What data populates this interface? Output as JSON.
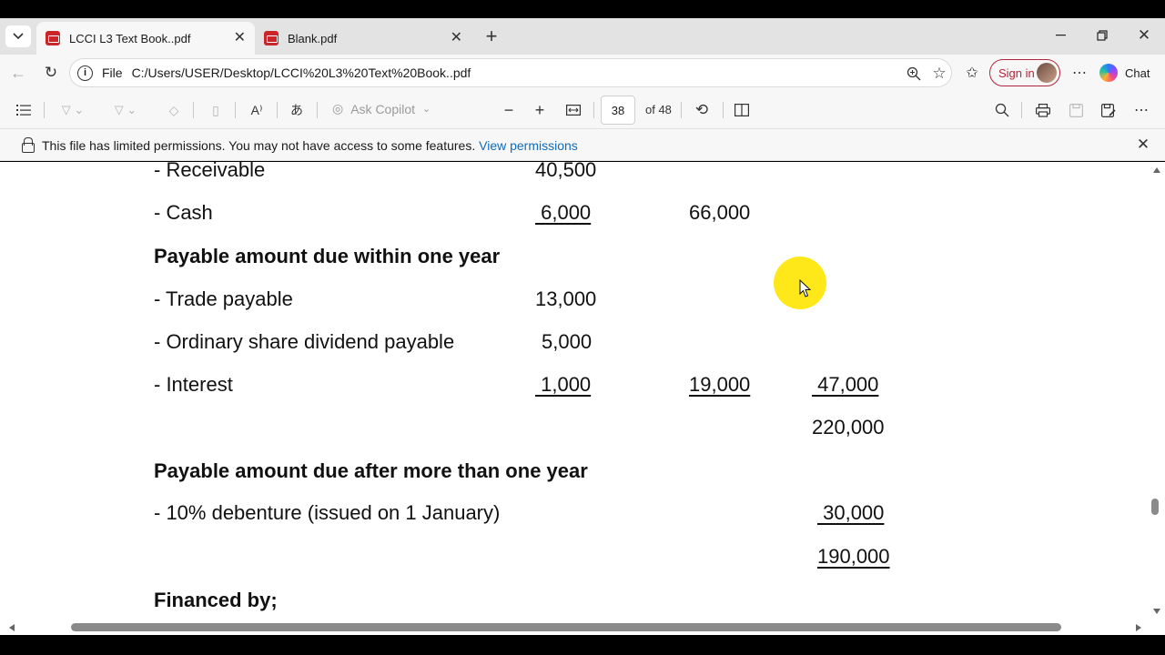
{
  "tabs": [
    {
      "label": "LCCI L3 Text Book..pdf",
      "active": true
    },
    {
      "label": "Blank.pdf",
      "active": false
    }
  ],
  "address": {
    "scheme_label": "File",
    "url": "C:/Users/USER/Desktop/LCCI%20L3%20Text%20Book..pdf"
  },
  "profile": {
    "signin_label": "Sign in"
  },
  "copilot": {
    "chat_label": "Chat"
  },
  "pdf_toolbar": {
    "ask_copilot": "Ask Copilot",
    "page_current": "38",
    "page_total": "of 48"
  },
  "infobar": {
    "message": "This file has limited permissions. You may not have access to some features.",
    "link": "View permissions"
  },
  "document": {
    "rows": [
      {
        "label": "- Receivable",
        "col1": "40,500",
        "col2": "",
        "col3": ""
      },
      {
        "label": "- Cash",
        "col1": " 6,000",
        "col2": "66,000",
        "col3": ""
      },
      {
        "heading": "Payable amount due within one year"
      },
      {
        "label": "- Trade payable",
        "col1": "13,000",
        "col2": "",
        "col3": ""
      },
      {
        "label": "- Ordinary share dividend payable",
        "col1": "5,000",
        "col2": "",
        "col3": ""
      },
      {
        "label": "- Interest",
        "col1": " 1,000",
        "col2": "19,000",
        "col3": " 47,000"
      },
      {
        "label": "",
        "col1": "",
        "col2": "",
        "col3": "220,000"
      },
      {
        "heading": "Payable amount due after more than one year"
      },
      {
        "label": "- 10% debenture (issued on 1 January)",
        "col1": "",
        "col2": "",
        "col3": " 30,000"
      },
      {
        "label": "",
        "col1": "",
        "col2": "",
        "col3": "190,000"
      },
      {
        "heading": "Financed by;"
      }
    ]
  },
  "colors": {
    "accent": "#0f6cbd",
    "signin": "#b3263a",
    "cursor_highlight": "#ffe81a"
  }
}
